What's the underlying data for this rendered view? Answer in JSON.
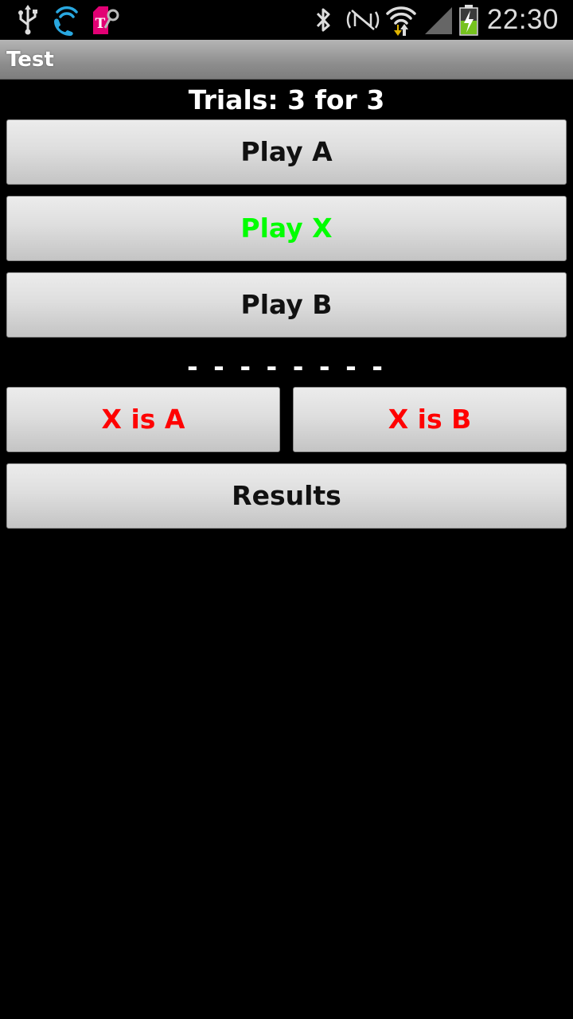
{
  "status_bar": {
    "time": "22:30",
    "icons": [
      "usb-icon",
      "wifi-call-icon",
      "carrier-app-icon",
      "bluetooth-icon",
      "nfc-icon",
      "wifi-icon",
      "signal-icon",
      "battery-charging-icon"
    ]
  },
  "app": {
    "title": "Test"
  },
  "main": {
    "trials_text": "Trials: 3 for 3",
    "play_a_label": "Play A",
    "play_x_label": "Play X",
    "play_b_label": "Play B",
    "separator": "- - - - - - - -",
    "x_is_a_label": "X is A",
    "x_is_b_label": "X is B",
    "results_label": "Results"
  },
  "colors": {
    "play_x_text": "#00ff00",
    "answer_text": "#ff0000",
    "default_text": "#111111",
    "background": "#000000"
  }
}
